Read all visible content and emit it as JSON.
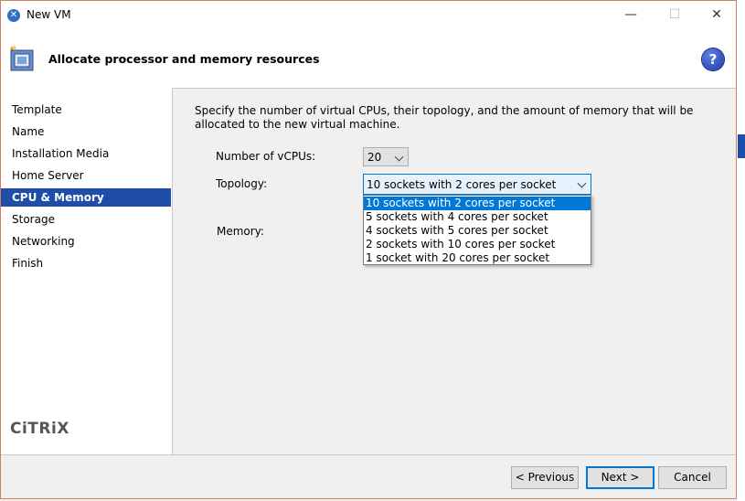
{
  "window": {
    "title": "New VM",
    "minimize": "—",
    "maximize": "☐",
    "close": "✕"
  },
  "header": {
    "title": "Allocate processor and memory resources",
    "help": "?"
  },
  "sidebar": {
    "items": [
      {
        "label": "Template"
      },
      {
        "label": "Name"
      },
      {
        "label": "Installation Media"
      },
      {
        "label": "Home Server"
      },
      {
        "label": "CPU & Memory",
        "active": true
      },
      {
        "label": "Storage"
      },
      {
        "label": "Networking"
      },
      {
        "label": "Finish"
      }
    ],
    "logo": "CiTRiX"
  },
  "content": {
    "description": "Specify the number of virtual CPUs, their topology, and the amount of memory that will be allocated to the new virtual machine.",
    "vcpus_label": "Number of vCPUs:",
    "vcpus_value": "20",
    "topology_label": "Topology:",
    "topology_value": "10 sockets with 2 cores per socket",
    "topology_options": [
      "10 sockets with 2 cores per socket",
      "5 sockets with 4 cores per socket",
      "4 sockets with 5 cores per socket",
      "2 sockets with 10 cores per socket",
      "1 socket with 20 cores per socket"
    ],
    "memory_label": "Memory:"
  },
  "footer": {
    "previous": "< Previous",
    "next": "Next >",
    "cancel": "Cancel"
  },
  "colors": {
    "accent": "#1e4ea8",
    "selection": "#0078d7"
  }
}
